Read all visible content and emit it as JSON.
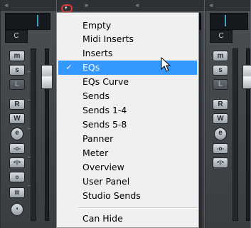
{
  "channels": [
    {
      "name": "C",
      "buttons": [
        "m",
        "s",
        "L",
        "R",
        "W",
        "e",
        "-o-",
        "<|>",
        "o",
        "III",
        "◖"
      ]
    },
    {
      "name": "C",
      "buttons": [
        "m",
        "s",
        "L",
        "R",
        "W",
        "e",
        "-o-",
        "<|>"
      ]
    }
  ],
  "strip_header_glyphs": [
    "«",
    "»",
    "«",
    "«"
  ],
  "menu": {
    "items": [
      {
        "label": "Empty",
        "checked": false
      },
      {
        "label": "Midi Inserts",
        "checked": false
      },
      {
        "label": "Inserts",
        "checked": false
      },
      {
        "label": "EQs",
        "checked": true
      },
      {
        "label": "EQs Curve",
        "checked": false
      },
      {
        "label": "Sends",
        "checked": false
      },
      {
        "label": "Sends 1-4",
        "checked": false
      },
      {
        "label": "Sends 5-8",
        "checked": false
      },
      {
        "label": "Panner",
        "checked": false
      },
      {
        "label": "Meter",
        "checked": false
      },
      {
        "label": "Overview",
        "checked": false
      },
      {
        "label": "User Panel",
        "checked": false
      },
      {
        "label": "Studio Sends",
        "checked": false
      }
    ],
    "footer_item": {
      "label": "Can Hide"
    },
    "check_glyph": "✓",
    "highlight_color": "#3399ff"
  },
  "trigger_glyph": "▾"
}
